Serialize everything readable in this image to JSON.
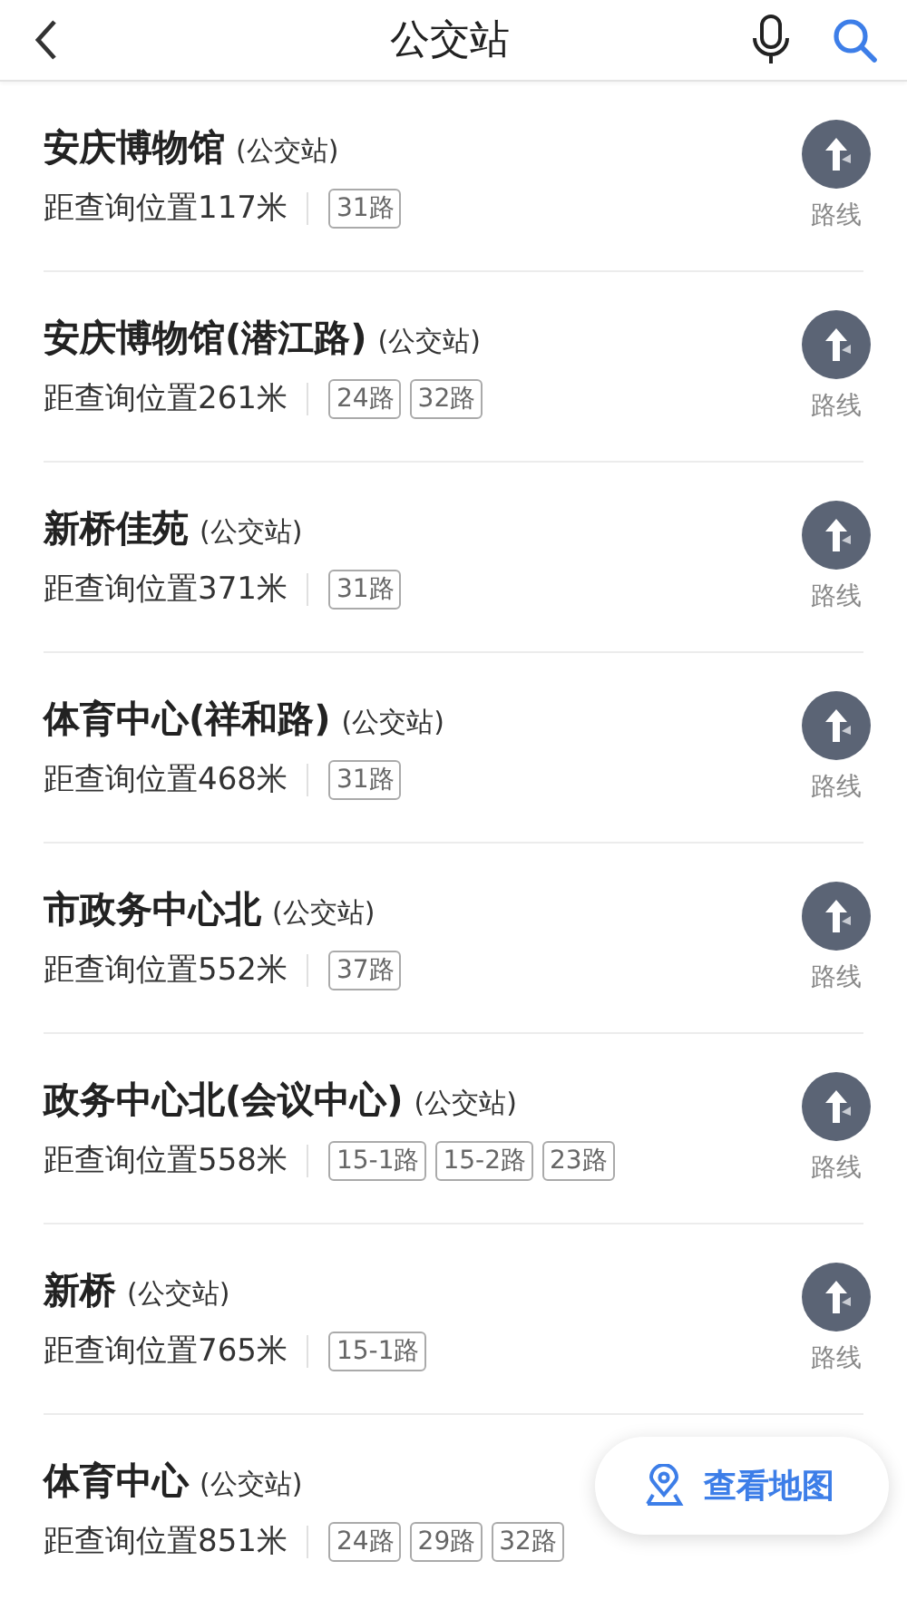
{
  "header": {
    "title": "公交站"
  },
  "stations": [
    {
      "name": "安庆博物馆",
      "type": "(公交站)",
      "distance": "距查询位置117米",
      "lines": [
        "31路"
      ],
      "route": "路线"
    },
    {
      "name": "安庆博物馆(潜江路)",
      "type": "(公交站)",
      "distance": "距查询位置261米",
      "lines": [
        "24路",
        "32路"
      ],
      "route": "路线"
    },
    {
      "name": "新桥佳苑",
      "type": "(公交站)",
      "distance": "距查询位置371米",
      "lines": [
        "31路"
      ],
      "route": "路线"
    },
    {
      "name": "体育中心(祥和路)",
      "type": "(公交站)",
      "distance": "距查询位置468米",
      "lines": [
        "31路"
      ],
      "route": "路线"
    },
    {
      "name": "市政务中心北",
      "type": "(公交站)",
      "distance": "距查询位置552米",
      "lines": [
        "37路"
      ],
      "route": "路线"
    },
    {
      "name": "政务中心北(会议中心)",
      "type": "(公交站)",
      "distance": "距查询位置558米",
      "lines": [
        "15-1路",
        "15-2路",
        "23路"
      ],
      "route": "路线"
    },
    {
      "name": "新桥",
      "type": "(公交站)",
      "distance": "距查询位置765米",
      "lines": [
        "15-1路"
      ],
      "route": "路线"
    },
    {
      "name": "体育中心",
      "type": "(公交站)",
      "distance": "距查询位置851米",
      "lines": [
        "24路",
        "29路",
        "32路"
      ]
    }
  ],
  "map_button": {
    "label": "查看地图"
  }
}
